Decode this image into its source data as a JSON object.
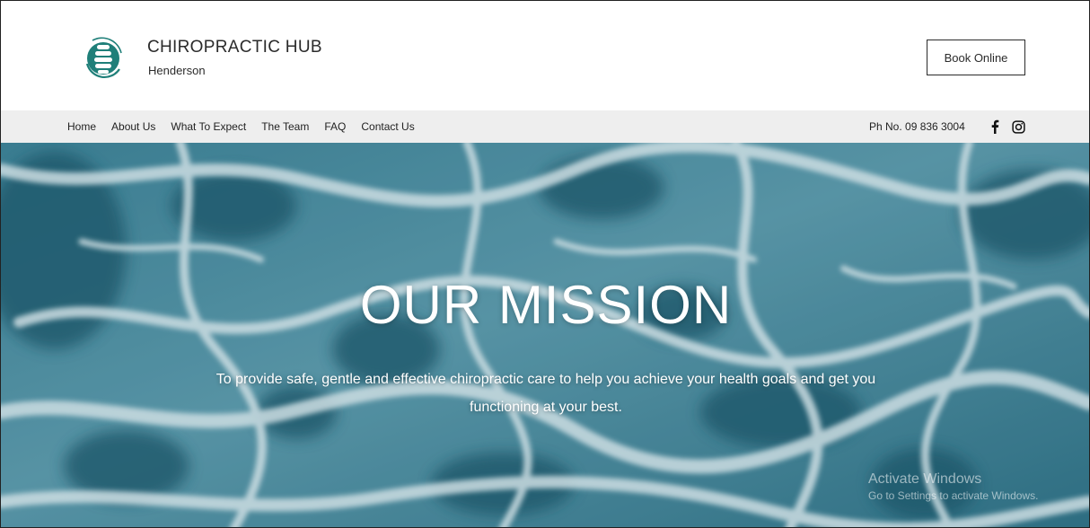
{
  "brand": {
    "title": "CHIROPRACTIC HUB",
    "subtitle": "Henderson",
    "accent_color": "#1f7f79"
  },
  "header": {
    "book_button_label": "Book Online"
  },
  "nav": {
    "items": [
      {
        "label": "Home"
      },
      {
        "label": "About Us"
      },
      {
        "label": "What To Expect"
      },
      {
        "label": "The Team"
      },
      {
        "label": "FAQ"
      },
      {
        "label": "Contact Us"
      }
    ],
    "phone": "Ph No. 09 836 3004",
    "social": [
      {
        "icon": "facebook-icon"
      },
      {
        "icon": "instagram-icon"
      }
    ]
  },
  "hero": {
    "title": "OUR MISSION",
    "text": "To provide safe, gentle and effective chiropractic care to help you achieve your health goals and get you functioning at your best."
  },
  "watermark": {
    "title": "Activate Windows",
    "subtitle": "Go to Settings to activate Windows."
  }
}
